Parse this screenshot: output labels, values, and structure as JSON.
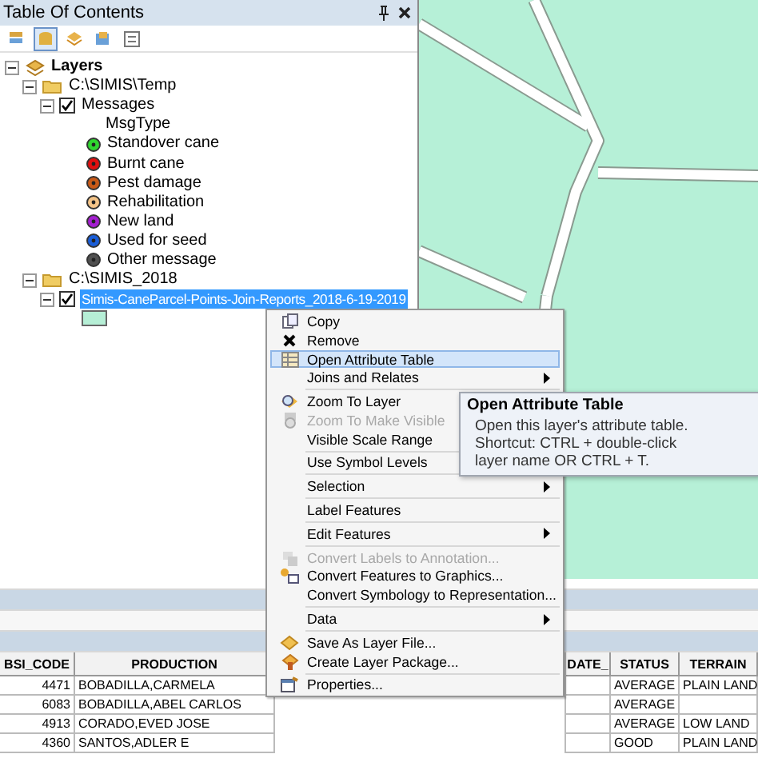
{
  "panel": {
    "title": "Table Of Contents",
    "toolbar": [
      {
        "kind": "order",
        "selected": false
      },
      {
        "kind": "source",
        "selected": true
      },
      {
        "kind": "visibility",
        "selected": false
      },
      {
        "kind": "selection",
        "selected": false
      },
      {
        "kind": "options",
        "selected": false
      }
    ]
  },
  "tree": {
    "kind": "frame",
    "label": "Layers",
    "expanded": true,
    "children": [
      {
        "kind": "folder",
        "label": "C:\\SIMIS\\Temp",
        "expanded": true,
        "children": [
          {
            "kind": "layer",
            "label": "Messages",
            "checked": true,
            "expanded": true,
            "selected": false,
            "legend": {
              "field": "MsgType",
              "classes": [
                {
                  "label": "Standover cane",
                  "color": "#2fd62f"
                },
                {
                  "label": "Burnt cane",
                  "color": "#e01010"
                },
                {
                  "label": "Pest damage",
                  "color": "#c85a18"
                },
                {
                  "label": "Rehabilitation",
                  "color": "#f4c488"
                },
                {
                  "label": "New land",
                  "color": "#a41fd0"
                },
                {
                  "label": "Used for seed",
                  "color": "#1a5ed8"
                },
                {
                  "label": "Other message",
                  "color": "#505050"
                }
              ]
            }
          }
        ]
      },
      {
        "kind": "folder",
        "label": "C:\\SIMIS_2018",
        "expanded": true,
        "children": [
          {
            "kind": "layer",
            "label": "Simis-CaneParcel-Points-Join-Reports_2018-6-19-2019",
            "checked": true,
            "expanded": true,
            "selected": true,
            "legend": {
              "color": "#b6efd6"
            }
          }
        ]
      }
    ]
  },
  "context_menu": {
    "groups": [
      [
        {
          "kind": "copy",
          "label": "Copy",
          "disabled": false,
          "selected": false
        },
        {
          "kind": "remove",
          "label": "Remove",
          "disabled": false,
          "selected": false
        },
        {
          "kind": "table",
          "label": "Open Attribute Table",
          "disabled": false,
          "selected": true
        },
        {
          "kind": "plain",
          "label": "Joins and Relates",
          "disabled": false,
          "selected": false,
          "submenu": true
        }
      ],
      [
        {
          "kind": "zoom",
          "label": "Zoom To Layer",
          "disabled": false,
          "selected": false
        },
        {
          "kind": "zoom-visible",
          "label": "Zoom To Make Visible",
          "disabled": true,
          "selected": false
        },
        {
          "kind": "plain",
          "label": "Visible Scale Range",
          "disabled": false,
          "selected": false
        }
      ],
      [
        {
          "kind": "plain",
          "label": "Use Symbol Levels",
          "disabled": false,
          "selected": false
        }
      ],
      [
        {
          "kind": "plain",
          "label": "Selection",
          "disabled": false,
          "selected": false,
          "submenu": true
        }
      ],
      [
        {
          "kind": "plain",
          "label": "Label Features",
          "disabled": false,
          "selected": false
        }
      ],
      [
        {
          "kind": "plain",
          "label": "Edit Features",
          "disabled": false,
          "selected": false,
          "submenu": true
        }
      ],
      [
        {
          "kind": "annotation",
          "label": "Convert Labels to Annotation...",
          "disabled": true,
          "selected": false
        },
        {
          "kind": "graphics",
          "label": "Convert Features to Graphics...",
          "disabled": false,
          "selected": false
        },
        {
          "kind": "plain",
          "label": "Convert Symbology to Representation...",
          "disabled": false,
          "selected": false
        }
      ],
      [
        {
          "kind": "plain",
          "label": "Data",
          "disabled": false,
          "selected": false,
          "submenu": true
        }
      ],
      [
        {
          "kind": "layer-file",
          "label": "Save As Layer File...",
          "disabled": false,
          "selected": false
        },
        {
          "kind": "package",
          "label": "Create Layer Package...",
          "disabled": false,
          "selected": false
        }
      ],
      [
        {
          "kind": "properties",
          "label": "Properties...",
          "disabled": false,
          "selected": false
        }
      ]
    ]
  },
  "tooltip": {
    "title": "Open Attribute Table",
    "body": "Open this layer's attribute table.\nShortcut: CTRL + double-click\nlayer name OR CTRL + T."
  },
  "table": {
    "columns": [
      "BSI_CODE",
      "PRODUCTION",
      "DATE_",
      "STATUS",
      "TERRAIN"
    ],
    "rows": [
      {
        "bsi_code": "4471",
        "production": "BOBADILLA,CARMELA",
        "status": "AVERAGE",
        "terrain": "PLAIN LAND"
      },
      {
        "bsi_code": "6083",
        "production": "BOBADILLA,ABEL CARLOS",
        "status": "AVERAGE"
      },
      {
        "bsi_code": "4913",
        "production": "CORADO,EVED JOSE",
        "status": "AVERAGE",
        "terrain": "LOW LAND"
      },
      {
        "bsi_code": "4360",
        "production": "SANTOS,ADLER E",
        "status": "GOOD",
        "terrain": "PLAIN LAND"
      }
    ]
  }
}
